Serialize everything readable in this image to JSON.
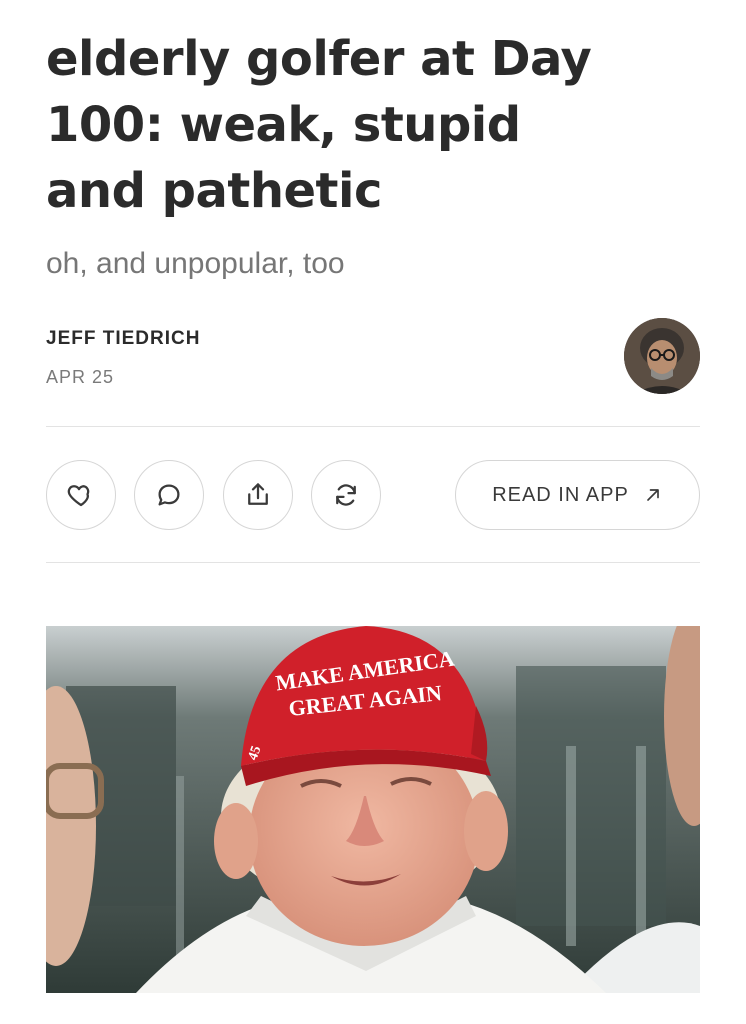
{
  "article": {
    "title_lines": [
      "elderly golfer at Day",
      "100: weak, stupid",
      "and pathetic"
    ],
    "subtitle": "oh, and unpopular, too",
    "author": "JEFF TIEDRICH",
    "date": "APR 25"
  },
  "actions": {
    "read_in_app_label": "READ IN APP",
    "icons": [
      "heart-icon",
      "comment-icon",
      "share-icon",
      "restack-icon",
      "arrow-up-right-icon"
    ]
  },
  "photo": {
    "cap_line1": "MAKE AMERICA",
    "cap_line2": "GREAT AGAIN",
    "cap_side": "45"
  },
  "colors": {
    "cap_red": "#d0202a",
    "icon_stroke": "#3a3a3a"
  }
}
